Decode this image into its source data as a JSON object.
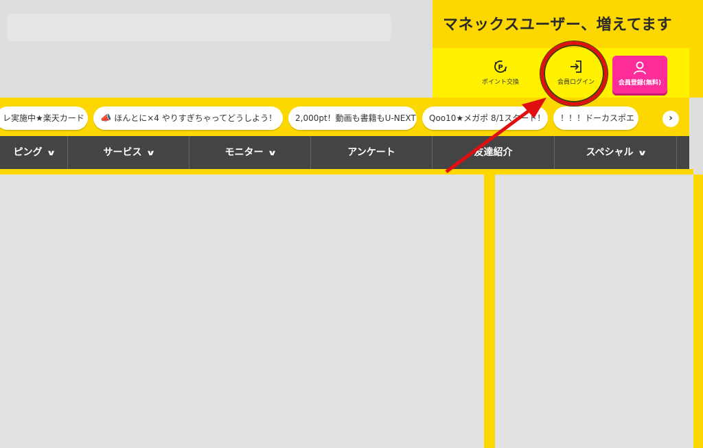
{
  "header": {
    "tagline": "マネックスユーザー、増えてます",
    "point_exchange_label": "ポイント交換",
    "member_login_label": "会員ログイン",
    "register_label": "会員登録(無料)"
  },
  "campaigns": [
    {
      "label": "レ実施中★楽天カード",
      "icon": ""
    },
    {
      "label": "ほんとに×4 やりすぎちゃってどうしよう！",
      "icon": "megaphone-icon"
    },
    {
      "label": "2,000pt！動画も書籍もU-NEXT",
      "icon": ""
    },
    {
      "label": "Qoo10★メガポ 8/1スタート！",
      "icon": ""
    },
    {
      "label": "！！！ドーカスポエ",
      "icon": ""
    }
  ],
  "nav": {
    "items": [
      {
        "label": "ピング",
        "has_dropdown": true
      },
      {
        "label": "サービス",
        "has_dropdown": true
      },
      {
        "label": "モニター",
        "has_dropdown": true
      },
      {
        "label": "アンケート",
        "has_dropdown": false
      },
      {
        "label": "友達紹介",
        "has_dropdown": false
      },
      {
        "label": "スペシャル",
        "has_dropdown": true
      }
    ]
  },
  "colors": {
    "brand_yellow": "#fcd700",
    "util_yellow": "#fff100",
    "register_pink": "#ff2d9a",
    "nav_dark": "#444444",
    "annotation_red": "#e01010"
  },
  "icons": {
    "point_exchange": "point-exchange-icon",
    "member_login": "login-icon",
    "register": "person-icon",
    "scroll_next": "chevron-right-icon",
    "dropdown": "chevron-down-icon"
  }
}
